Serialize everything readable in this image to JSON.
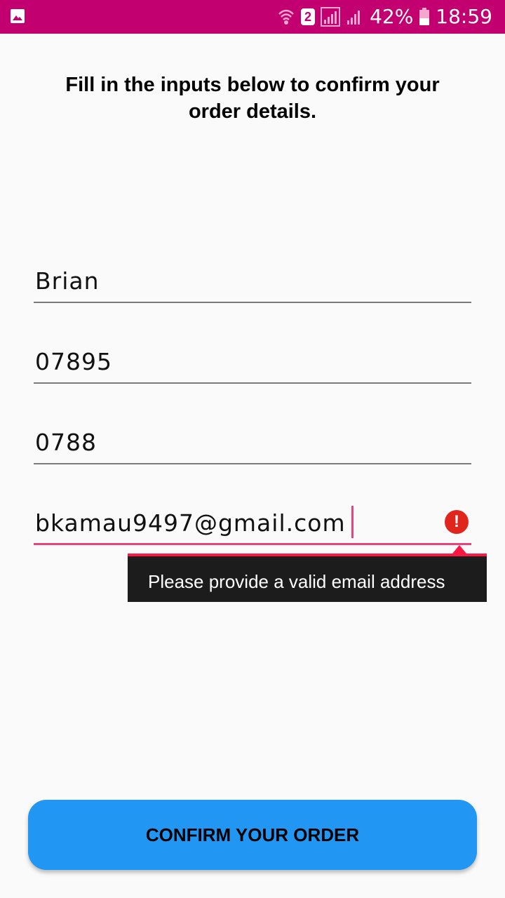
{
  "status_bar": {
    "background": "#c2006f",
    "left_icons": [
      "gallery-icon"
    ],
    "right_icons": [
      "wifi-call-icon",
      "sim-2-icon",
      "signal-icon",
      "signal-icon",
      "battery-icon"
    ],
    "sim_label": "2",
    "battery_percent": "42%",
    "time": "18:59"
  },
  "form": {
    "instructions": "Fill in the inputs below to confirm your order details.",
    "fields": [
      {
        "value": "Brian"
      },
      {
        "value": "07895"
      },
      {
        "value": "0788"
      },
      {
        "value": "bkamau9497@gmail.com",
        "has_error": true,
        "focused": true
      }
    ],
    "error_message": "Please provide a valid email address",
    "error_icon": "alert-circle-icon",
    "accent_color": "#e8437a",
    "error_color": "#ff1744"
  },
  "confirm_button": {
    "label": "CONFIRM YOUR ORDER",
    "color": "#2196f3"
  }
}
